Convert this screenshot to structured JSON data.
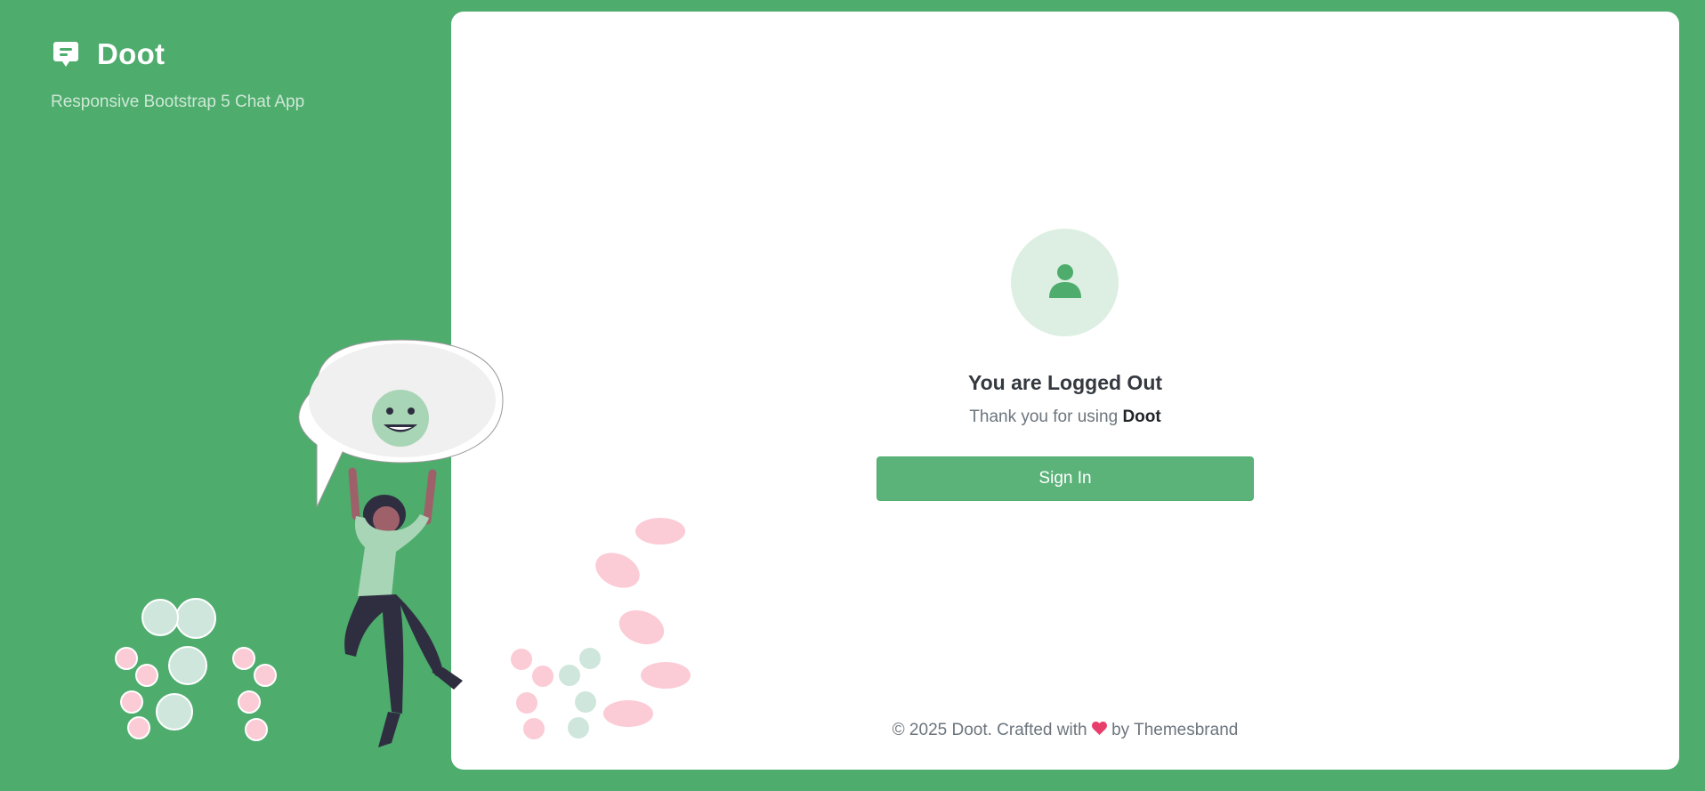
{
  "brand": {
    "name": "Doot",
    "tagline": "Responsive Bootstrap 5 Chat App",
    "icon": "chat-square-icon"
  },
  "logout": {
    "title": "You are Logged Out",
    "thanks_prefix": "Thank you for using ",
    "thanks_app": "Doot",
    "button_label": "Sign In",
    "avatar_icon": "user-icon"
  },
  "footer": {
    "prefix": "© 2025 Doot. Crafted with ",
    "heart_icon": "heart-icon",
    "suffix": " by Themesbrand"
  },
  "colors": {
    "primary": "#4eac6d",
    "button": "#5bb37a",
    "avatar_bg": "#dcefe2",
    "heart": "#e83e6c"
  }
}
